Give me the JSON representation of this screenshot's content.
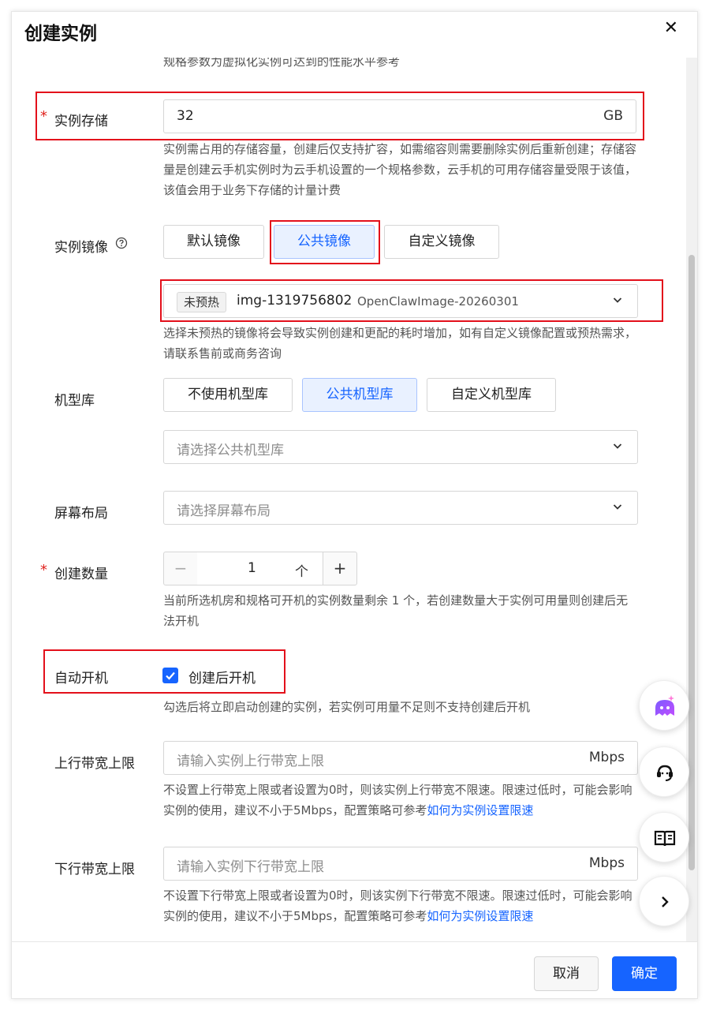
{
  "dialog": {
    "title": "创建实例",
    "close_glyph": "✕",
    "cancel_label": "取消",
    "confirm_label": "确定"
  },
  "spec_note": "规格参数为虚拟化实例可达到的性能水平参考",
  "storage": {
    "label": "实例存储",
    "required_mark": "*",
    "value": "32",
    "unit": "GB",
    "help": "实例需占用的存储容量，创建后仅支持扩容，如需缩容则需要删除实例后重新创建；存储容量是创建云手机实例时为云手机设置的一个规格参数，云手机的可用存储容量受限于该值，该值会用于业务下存储的计量计费"
  },
  "image": {
    "label": "实例镜像",
    "options": [
      "默认镜像",
      "公共镜像",
      "自定义镜像"
    ],
    "selected": "公共镜像",
    "tag": "未预热",
    "image_id": "img-1319756802",
    "image_name": "OpenClawImage-20260301",
    "help": "选择未预热的镜像将会导致实例创建和更配的耗时增加，如有自定义镜像配置或预热需求，请联系售前或商务咨询"
  },
  "model_lib": {
    "label": "机型库",
    "options": [
      "不使用机型库",
      "公共机型库",
      "自定义机型库"
    ],
    "selected": "公共机型库",
    "placeholder": "请选择公共机型库"
  },
  "screen_layout": {
    "label": "屏幕布局",
    "placeholder": "请选择屏幕布局"
  },
  "count": {
    "label": "创建数量",
    "required_mark": "*",
    "minus": "−",
    "plus": "+",
    "value": "1",
    "unit": "个",
    "help": "当前所选机房和规格可开机的实例数量剩余 1 个，若创建数量大于实例可用量则创建后无法开机"
  },
  "auto_start": {
    "label": "自动开机",
    "checkbox_label": "创建后开机",
    "checked": true,
    "help": "勾选后将立即启动创建的实例，若实例可用量不足则不支持创建后开机"
  },
  "uplink": {
    "label": "上行带宽上限",
    "placeholder": "请输入实例上行带宽上限",
    "unit": "Mbps",
    "help": "不设置上行带宽上限或者设置为0时，则该实例上行带宽不限速。限速过低时，可能会影响实例的使用，建议不小于5Mbps，配置策略可参考",
    "link": "如何为实例设置限速"
  },
  "downlink": {
    "label": "下行带宽上限",
    "placeholder": "请输入实例下行带宽上限",
    "unit": "Mbps",
    "help": "不设置下行带宽上限或者设置为0时，则该实例下行带宽不限速。限速过低时，可能会影响实例的使用，建议不小于5Mbps，配置策略可参考",
    "link": "如何为实例设置限速"
  },
  "colors": {
    "primary": "#1664ff",
    "highlight_box": "#e3101b",
    "required": "#e0241f"
  },
  "icons": [
    "close-icon",
    "help-circle-icon",
    "chevron-down-icon",
    "check-icon",
    "ai-assistant-icon",
    "customer-service-icon",
    "docs-book-icon",
    "chevron-right-icon"
  ]
}
